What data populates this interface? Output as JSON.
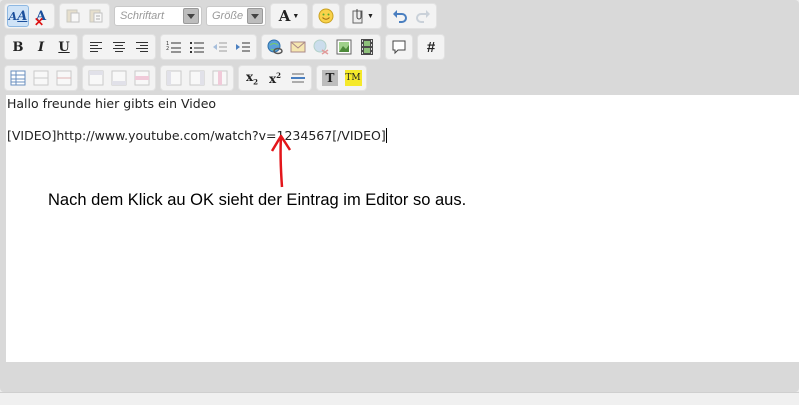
{
  "toolbar": {
    "font_select": "Schriftart",
    "size_select": "Größe",
    "text_color_label": "A",
    "bold_label": "B",
    "italic_label": "I",
    "underline_label": "U",
    "hash_label": "#",
    "tm_label": "TM",
    "subscript_label": "x",
    "subscript_sub": "2",
    "superscript_label": "x",
    "superscript_sup": "2",
    "t_label": "T",
    "icons": [
      "switch-mode-icon",
      "remove-format-icon",
      "paste-icon",
      "paste-text-icon",
      "font-color-icon",
      "smiley-icon",
      "attachment-icon",
      "undo-icon",
      "redo-icon",
      "align-left-icon",
      "align-center-icon",
      "align-right-icon",
      "ordered-list-icon",
      "unordered-list-icon",
      "outdent-icon",
      "indent-icon",
      "link-icon",
      "email-icon",
      "unlink-icon",
      "image-icon",
      "video-icon",
      "quote-icon",
      "code-icon",
      "table-icon",
      "insert-row-icon",
      "delete-row-icon",
      "insert-column-icon",
      "delete-column-icon",
      "merge-cells-icon",
      "split-cells-icon",
      "horizontal-rule-icon",
      "teletype-icon",
      "trademark-icon"
    ]
  },
  "editor": {
    "line1": "Hallo freunde hier gibts ein Video",
    "line2": "[VIDEO]http://www.youtube.com/watch?v=1234567[/VIDEO]"
  },
  "annotation": {
    "text": "Nach dem Klick au OK sieht der Eintrag im Editor so aus.",
    "arrow_color": "#e3161b"
  }
}
